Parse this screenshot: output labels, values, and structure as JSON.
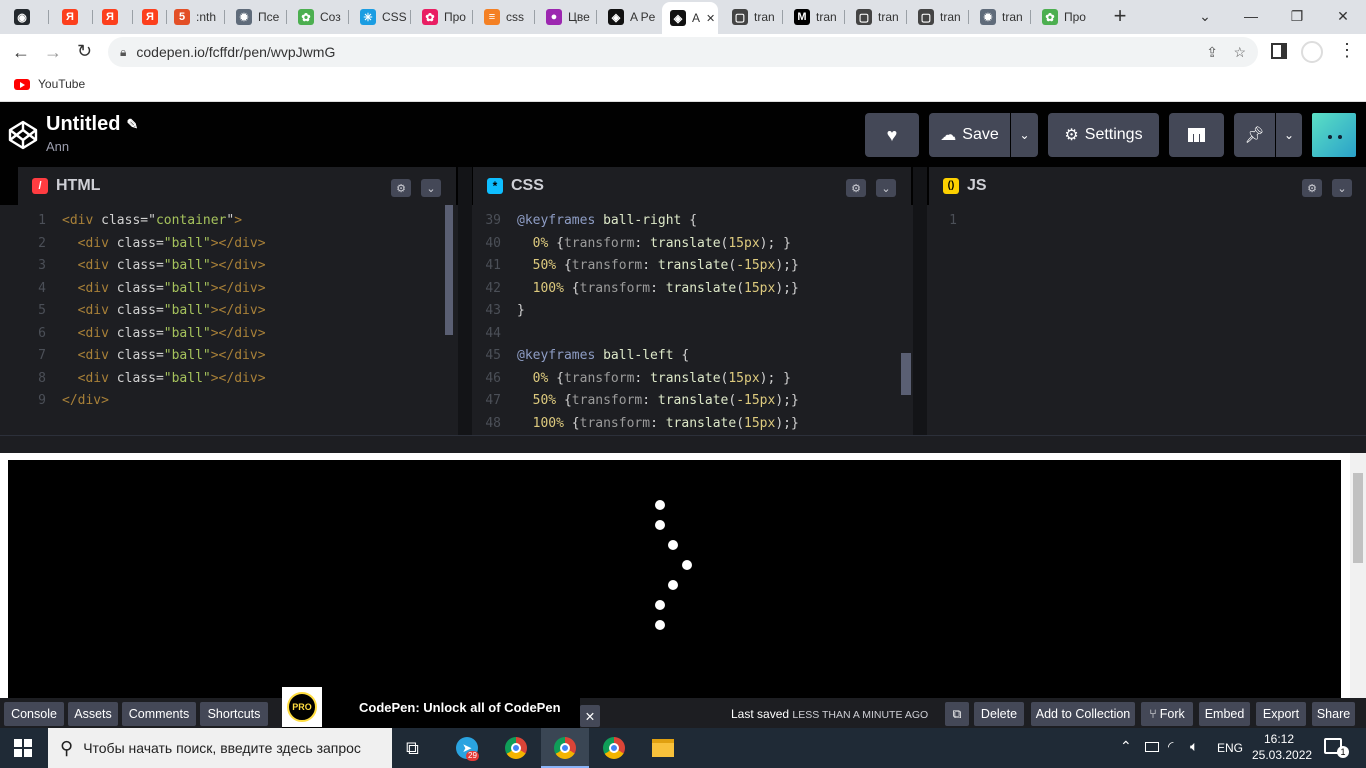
{
  "browser": {
    "tabs": [
      {
        "label": "",
        "icon": "github-icon",
        "color": "#24292e",
        "glyph": "◉"
      },
      {
        "label": "",
        "icon": "yandex-icon",
        "color": "#fc3f1d",
        "glyph": "Я"
      },
      {
        "label": "",
        "icon": "yandex-icon",
        "color": "#fc3f1d",
        "glyph": "Я"
      },
      {
        "label": "",
        "icon": "yandex-icon",
        "color": "#fc3f1d",
        "glyph": "Я"
      },
      {
        "label": ":nth",
        "icon": "html5-icon",
        "color": "#e34f26",
        "glyph": "5"
      },
      {
        "label": "Псе",
        "icon": "gear-wheel-icon",
        "color": "#5f6b7a",
        "glyph": "✹"
      },
      {
        "label": "Соз",
        "icon": "pinwheel-icon",
        "color": "#4caf50",
        "glyph": "✿"
      },
      {
        "label": "CSS",
        "icon": "css-star-icon",
        "color": "#1b9de2",
        "glyph": "✳"
      },
      {
        "label": "Про",
        "icon": "pinwheel-icon",
        "color": "#e91e63",
        "glyph": "✿"
      },
      {
        "label": "css",
        "icon": "stackoverflow-icon",
        "color": "#f48024",
        "glyph": "≡"
      },
      {
        "label": "Цве",
        "icon": "color-wheel-icon",
        "color": "#9c27b0",
        "glyph": "●"
      },
      {
        "label": "A Pe",
        "icon": "codepen-icon",
        "color": "#111111",
        "glyph": "◈"
      },
      {
        "label": "A",
        "icon": "codepen-icon",
        "color": "#111111",
        "glyph": "◈"
      },
      {
        "label": "tran",
        "icon": "speech-bubble-icon",
        "color": "#444444",
        "glyph": "▢"
      },
      {
        "label": "tran",
        "icon": "medium-icon",
        "color": "#000000",
        "glyph": "M"
      },
      {
        "label": "tran",
        "icon": "speech-bubble-icon",
        "color": "#444444",
        "glyph": "▢"
      },
      {
        "label": "tran",
        "icon": "speech-bubble-icon",
        "color": "#444444",
        "glyph": "▢"
      },
      {
        "label": "tran",
        "icon": "gear-wheel-icon",
        "color": "#5f6b7a",
        "glyph": "✹"
      },
      {
        "label": "Про",
        "icon": "pinwheel-icon",
        "color": "#4caf50",
        "glyph": "✿"
      }
    ],
    "new_tab": "+",
    "url": "codepen.io/fcffdr/pen/wvpJwmG",
    "bookmark": "YouTube"
  },
  "codepen": {
    "title": "Untitled",
    "author": "Ann",
    "save_label": "Save",
    "settings_label": "Settings",
    "html_label": "HTML",
    "css_label": "CSS",
    "js_label": "JS"
  },
  "html_code": {
    "gutter": [
      "1",
      "2",
      "3",
      "4",
      "5",
      "6",
      "7",
      "8",
      "9"
    ],
    "lines": [
      [
        [
          "t-tag",
          "<div "
        ],
        [
          "t-attr",
          "class"
        ],
        [
          "t-plain",
          "=\""
        ],
        [
          "t-str",
          "container"
        ],
        [
          "t-plain",
          "\""
        ],
        [
          "t-tag",
          ">"
        ]
      ],
      [
        [
          "t-plain",
          "  "
        ],
        [
          "t-tag",
          "<div "
        ],
        [
          "t-attr",
          "class"
        ],
        [
          "t-plain",
          "="
        ],
        [
          "t-str",
          "\"ball\""
        ],
        [
          "t-tag",
          "></div>"
        ]
      ],
      [
        [
          "t-plain",
          "  "
        ],
        [
          "t-tag",
          "<div "
        ],
        [
          "t-attr",
          "class"
        ],
        [
          "t-plain",
          "="
        ],
        [
          "t-str",
          "\"ball\""
        ],
        [
          "t-tag",
          "></div>"
        ]
      ],
      [
        [
          "t-plain",
          "  "
        ],
        [
          "t-tag",
          "<div "
        ],
        [
          "t-attr",
          "class"
        ],
        [
          "t-plain",
          "="
        ],
        [
          "t-str",
          "\"ball\""
        ],
        [
          "t-tag",
          "></div>"
        ]
      ],
      [
        [
          "t-plain",
          "  "
        ],
        [
          "t-tag",
          "<div "
        ],
        [
          "t-attr",
          "class"
        ],
        [
          "t-plain",
          "="
        ],
        [
          "t-str",
          "\"ball\""
        ],
        [
          "t-tag",
          "></div>"
        ]
      ],
      [
        [
          "t-plain",
          "  "
        ],
        [
          "t-tag",
          "<div "
        ],
        [
          "t-attr",
          "class"
        ],
        [
          "t-plain",
          "="
        ],
        [
          "t-str",
          "\"ball\""
        ],
        [
          "t-tag",
          "></div>"
        ]
      ],
      [
        [
          "t-plain",
          "  "
        ],
        [
          "t-tag",
          "<div "
        ],
        [
          "t-attr",
          "class"
        ],
        [
          "t-plain",
          "="
        ],
        [
          "t-str",
          "\"ball\""
        ],
        [
          "t-tag",
          "></div>"
        ]
      ],
      [
        [
          "t-plain",
          "  "
        ],
        [
          "t-tag",
          "<div "
        ],
        [
          "t-attr",
          "class"
        ],
        [
          "t-plain",
          "="
        ],
        [
          "t-str",
          "\"ball\""
        ],
        [
          "t-tag",
          "></div>"
        ]
      ],
      [
        [
          "t-tag",
          "</div>"
        ]
      ]
    ]
  },
  "css_code": {
    "gutter": [
      "39",
      "40",
      "41",
      "42",
      "43",
      "44",
      "45",
      "46",
      "47",
      "48"
    ],
    "lines": [
      [
        [
          "t-at",
          "@keyframes "
        ],
        [
          "t-kw",
          "ball-right "
        ],
        [
          "t-plain",
          "{"
        ]
      ],
      [
        [
          "t-plain",
          "  "
        ],
        [
          "t-pct",
          "0% "
        ],
        [
          "t-plain",
          "{"
        ],
        [
          "t-prop",
          "transform"
        ],
        [
          "t-plain",
          ": "
        ],
        [
          "t-kw",
          "translate"
        ],
        [
          "t-plain",
          "("
        ],
        [
          "t-num",
          "15px"
        ],
        [
          "t-plain",
          "); }"
        ]
      ],
      [
        [
          "t-plain",
          "  "
        ],
        [
          "t-pct",
          "50% "
        ],
        [
          "t-plain",
          "{"
        ],
        [
          "t-prop",
          "transform"
        ],
        [
          "t-plain",
          ": "
        ],
        [
          "t-kw",
          "translate"
        ],
        [
          "t-plain",
          "("
        ],
        [
          "t-num",
          "-15px"
        ],
        [
          "t-plain",
          ");}"
        ]
      ],
      [
        [
          "t-plain",
          "  "
        ],
        [
          "t-pct",
          "100% "
        ],
        [
          "t-plain",
          "{"
        ],
        [
          "t-prop",
          "transform"
        ],
        [
          "t-plain",
          ": "
        ],
        [
          "t-kw",
          "translate"
        ],
        [
          "t-plain",
          "("
        ],
        [
          "t-num",
          "15px"
        ],
        [
          "t-plain",
          ");}"
        ]
      ],
      [
        [
          "t-plain",
          "}"
        ]
      ],
      [
        [
          "t-plain",
          ""
        ]
      ],
      [
        [
          "t-at",
          "@keyframes "
        ],
        [
          "t-kw",
          "ball-left "
        ],
        [
          "t-plain",
          "{"
        ]
      ],
      [
        [
          "t-plain",
          "  "
        ],
        [
          "t-pct",
          "0% "
        ],
        [
          "t-plain",
          "{"
        ],
        [
          "t-prop",
          "transform"
        ],
        [
          "t-plain",
          ": "
        ],
        [
          "t-kw",
          "translate"
        ],
        [
          "t-plain",
          "("
        ],
        [
          "t-num",
          "15px"
        ],
        [
          "t-plain",
          "); }"
        ]
      ],
      [
        [
          "t-plain",
          "  "
        ],
        [
          "t-pct",
          "50% "
        ],
        [
          "t-plain",
          "{"
        ],
        [
          "t-prop",
          "transform"
        ],
        [
          "t-plain",
          ": "
        ],
        [
          "t-kw",
          "translate"
        ],
        [
          "t-plain",
          "("
        ],
        [
          "t-num",
          "-15px"
        ],
        [
          "t-plain",
          ");}"
        ]
      ],
      [
        [
          "t-plain",
          "  "
        ],
        [
          "t-pct",
          "100% "
        ],
        [
          "t-plain",
          "{"
        ],
        [
          "t-prop",
          "transform"
        ],
        [
          "t-plain",
          ": "
        ],
        [
          "t-kw",
          "translate"
        ],
        [
          "t-plain",
          "("
        ],
        [
          "t-num",
          "15px"
        ],
        [
          "t-plain",
          ");}"
        ]
      ]
    ]
  },
  "js_code": {
    "gutter": [
      "1"
    ]
  },
  "footer": {
    "console": "Console",
    "assets": "Assets",
    "comments": "Comments",
    "shortcuts": "Shortcuts",
    "promo_badge": "PRO",
    "promo_text": "CodePen: Unlock all of CodePen",
    "promo_close": "✕",
    "saved_label": "Last saved",
    "saved_value": "LESS THAN A MINUTE AGO",
    "delete": "Delete",
    "add_collection": "Add to Collection",
    "fork": "Fork",
    "embed": "Embed",
    "export": "Export",
    "share": "Share"
  },
  "taskbar": {
    "search_placeholder": "Чтобы начать поиск, введите здесь запрос",
    "lang": "ENG",
    "time": "16:12",
    "date": "25.03.2022",
    "telegram_badge": "29",
    "notif_count": "1"
  }
}
